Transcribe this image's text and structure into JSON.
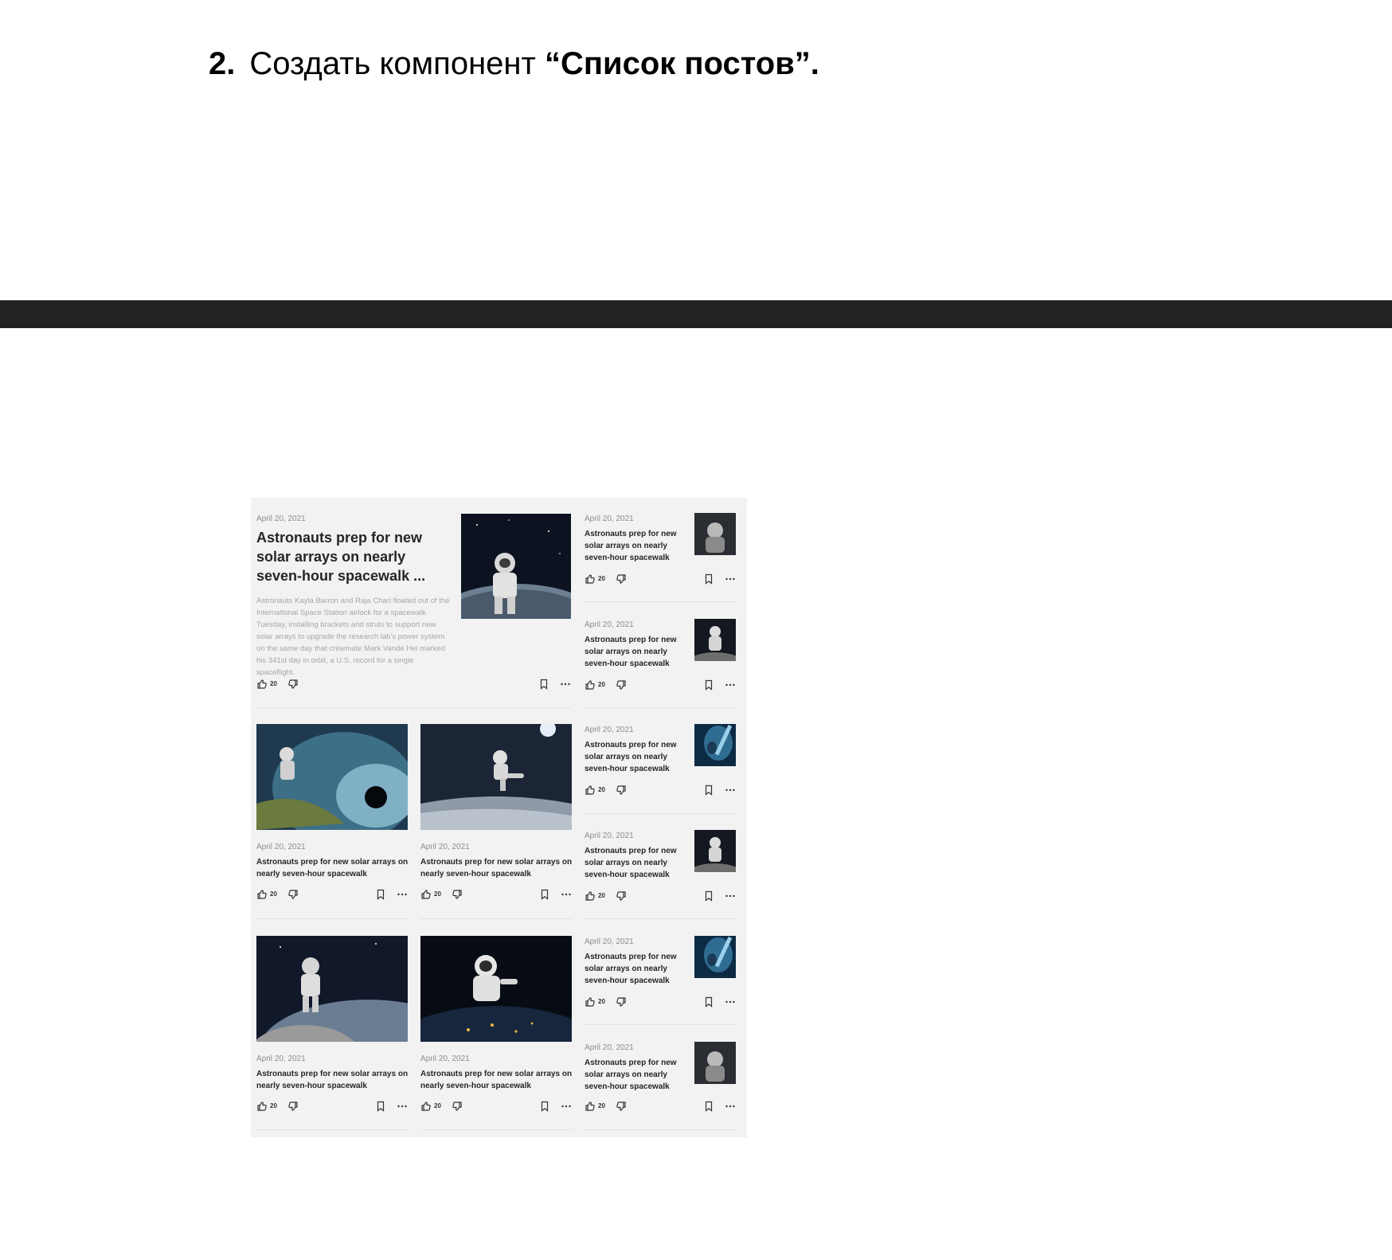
{
  "heading": {
    "number": "2.",
    "text": "Создать компонент ",
    "emphasis": "“Список постов”."
  },
  "featured": {
    "date": "April 20, 2021",
    "title": "Astronauts prep for new solar arrays on nearly seven-hour spacewalk ...",
    "excerpt": "Astronauts Kayla Barron and Raja Chari floated out of the International Space Station airlock for a spacewalk Tuesday, installing brackets and struts to support new solar arrays to upgrade the research lab's power system on the same day that crewmate Mark Vande Hei marked his 341st day in orbit, a U.S. record for a single spaceflight.",
    "likes": "20"
  },
  "grid_posts": [
    {
      "date": "April 20, 2021",
      "title": "Astronauts prep for new solar arrays on nearly seven-hour spacewalk",
      "likes": "20"
    },
    {
      "date": "April 20, 2021",
      "title": "Astronauts prep for new solar arrays on nearly seven-hour spacewalk",
      "likes": "20"
    },
    {
      "date": "April 20, 2021",
      "title": "Astronauts prep for new solar arrays on nearly seven-hour spacewalk",
      "likes": "20"
    },
    {
      "date": "April 20, 2021",
      "title": "Astronauts prep for new solar arrays on nearly seven-hour spacewalk",
      "likes": "20"
    }
  ],
  "side_posts": [
    {
      "date": "April 20, 2021",
      "title": "Astronauts prep for new solar arrays on nearly seven-hour spacewalk",
      "likes": "20"
    },
    {
      "date": "April 20, 2021",
      "title": "Astronauts prep for new solar arrays on nearly seven-hour spacewalk",
      "likes": "20"
    },
    {
      "date": "April 20, 2021",
      "title": "Astronauts prep for new solar arrays on nearly seven-hour spacewalk",
      "likes": "20"
    },
    {
      "date": "April 20, 2021",
      "title": "Astronauts prep for new solar arrays on nearly seven-hour spacewalk",
      "likes": "20"
    },
    {
      "date": "April 20, 2021",
      "title": "Astronauts prep for new solar arrays on nearly seven-hour spacewalk",
      "likes": "20"
    },
    {
      "date": "April 20, 2021",
      "title": "Astronauts prep for new solar arrays on nearly seven-hour spacewalk",
      "likes": "20"
    }
  ],
  "icons": {
    "like": "thumbs-up-icon",
    "dislike": "thumbs-down-icon",
    "bookmark": "bookmark-icon",
    "more": "more-icon"
  },
  "colors": {
    "band": "#222222",
    "mockup_background": "#f2f2f2",
    "title_text": "#262626",
    "muted_text": "#8d8d8d"
  }
}
